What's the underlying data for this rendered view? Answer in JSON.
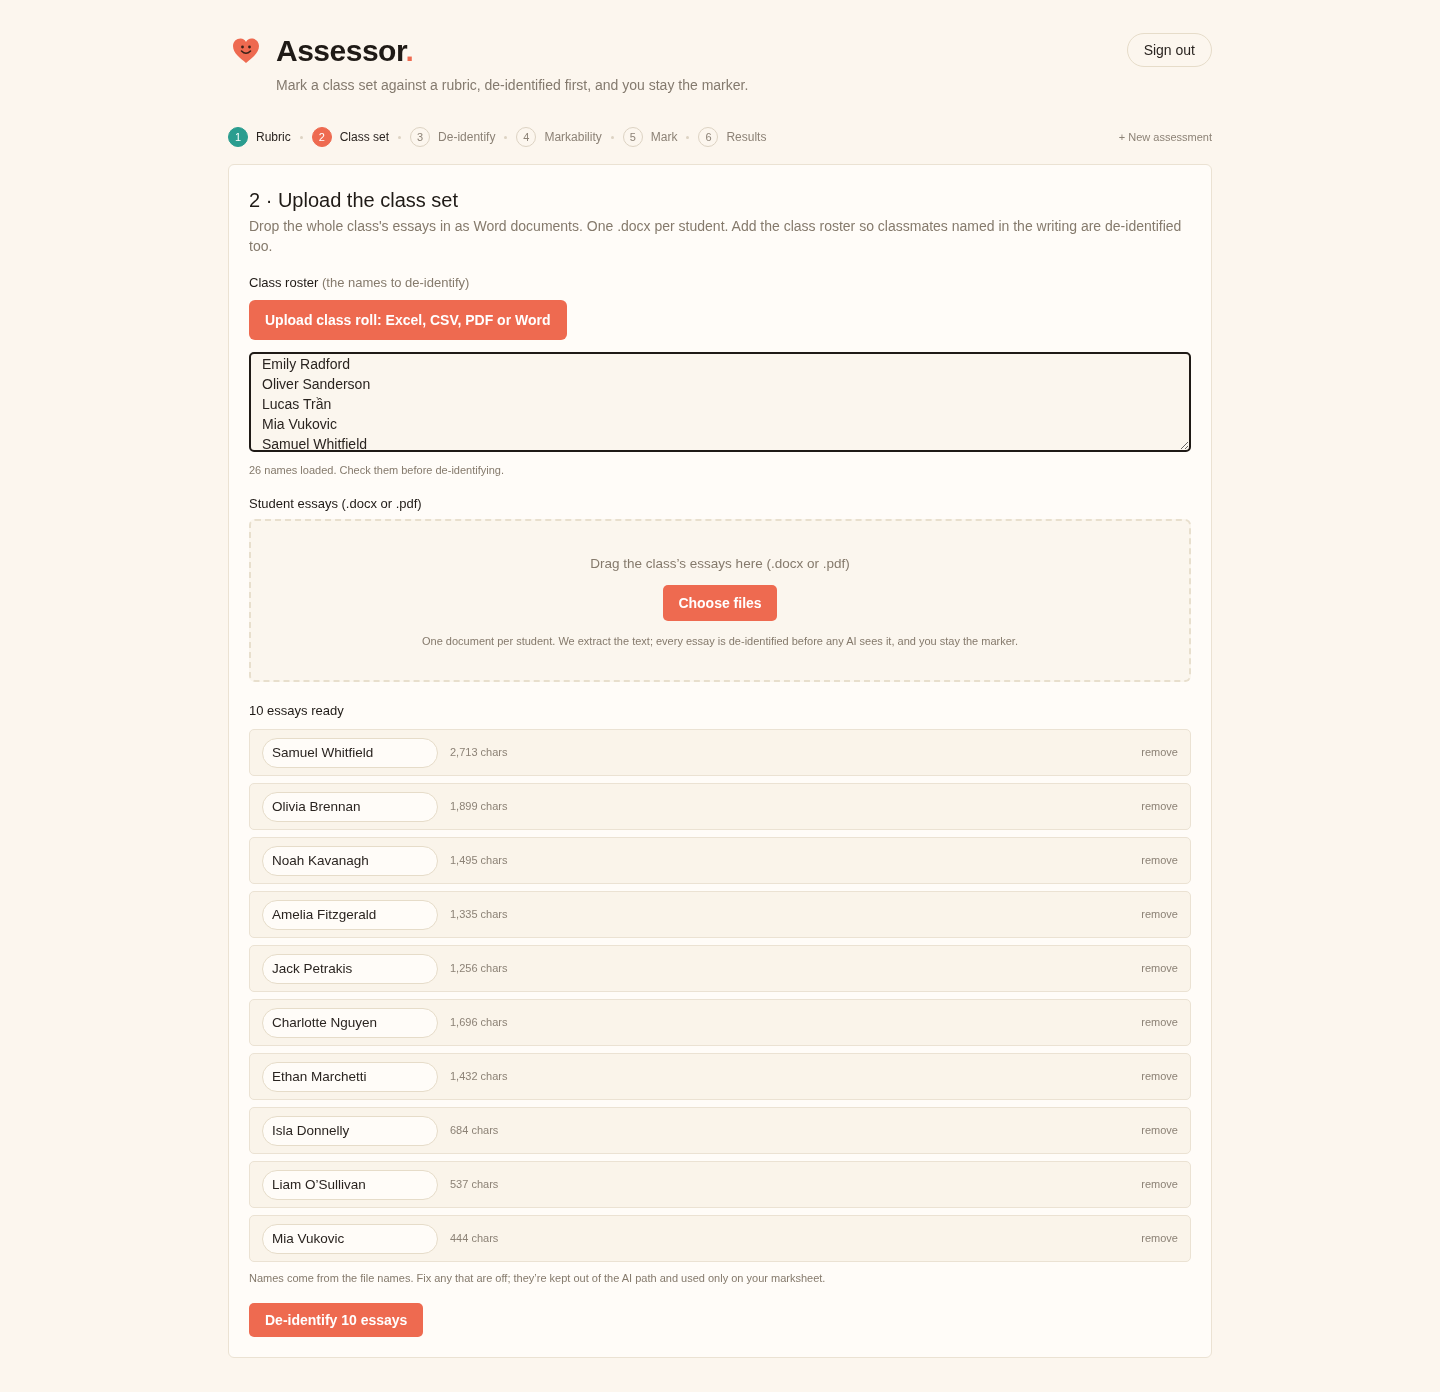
{
  "header": {
    "wordmark": "Assessor",
    "wordmark_dot": ".",
    "tagline": "Mark a class set against a rubric, de-identified first, and you stay the marker.",
    "sign_out": "Sign out"
  },
  "steps": [
    {
      "number": "1",
      "label": "Rubric",
      "done": true,
      "selected": false
    },
    {
      "number": "2",
      "label": "Class set",
      "done": false,
      "selected": true
    },
    {
      "number": "3",
      "label": "De-identify",
      "done": false,
      "selected": false
    },
    {
      "number": "4",
      "label": "Markability",
      "done": false,
      "selected": false
    },
    {
      "number": "5",
      "label": "Mark",
      "done": false,
      "selected": false
    },
    {
      "number": "6",
      "label": "Results",
      "done": false,
      "selected": false
    }
  ],
  "new_assessment": "+ New assessment",
  "panel": {
    "title": "2 · Upload the class set",
    "description": "Drop the whole class's essays in as Word documents. One .docx per student. Add the class roster so classmates named in the writing are de-identified too.",
    "roster": {
      "label": "Class roster",
      "hint": "(the names to de-identify)",
      "upload_button": "Upload class roll: Excel, CSV, PDF or Word",
      "names": [
        "Emily Radford",
        "Oliver Sanderson",
        "Lucas Trần",
        "Mia Vukovic",
        "Samuel Whitfield"
      ],
      "note": "26 names loaded. Check them before de-identifying."
    },
    "essays": {
      "label": "Student essays (.docx or .pdf)",
      "drop_prompt": "Drag the class’s essays here (.docx or .pdf)",
      "choose_button": "Choose files",
      "drop_note": "One document per student. We extract the text; every essay is de-identified before any AI sees it, and you stay the marker.",
      "ready": "10 essays ready",
      "items": [
        {
          "name": "Samuel Whitfield",
          "chars": "2,713 chars",
          "remove": "remove"
        },
        {
          "name": "Olivia Brennan",
          "chars": "1,899 chars",
          "remove": "remove"
        },
        {
          "name": "Noah Kavanagh",
          "chars": "1,495 chars",
          "remove": "remove"
        },
        {
          "name": "Amelia Fitzgerald",
          "chars": "1,335 chars",
          "remove": "remove"
        },
        {
          "name": "Jack Petrakis",
          "chars": "1,256 chars",
          "remove": "remove"
        },
        {
          "name": "Charlotte Nguyen",
          "chars": "1,696 chars",
          "remove": "remove"
        },
        {
          "name": "Ethan Marchetti",
          "chars": "1,432 chars",
          "remove": "remove"
        },
        {
          "name": "Isla Donnelly",
          "chars": "684 chars",
          "remove": "remove"
        },
        {
          "name": "Liam O’Sullivan",
          "chars": "537 chars",
          "remove": "remove"
        },
        {
          "name": "Mia Vukovic",
          "chars": "444 chars",
          "remove": "remove"
        }
      ],
      "note": "Names come from the file names. Fix any that are off; they’re kept out of the AI path and used only on your marksheet.",
      "submit": "De-identify 10 essays"
    }
  }
}
